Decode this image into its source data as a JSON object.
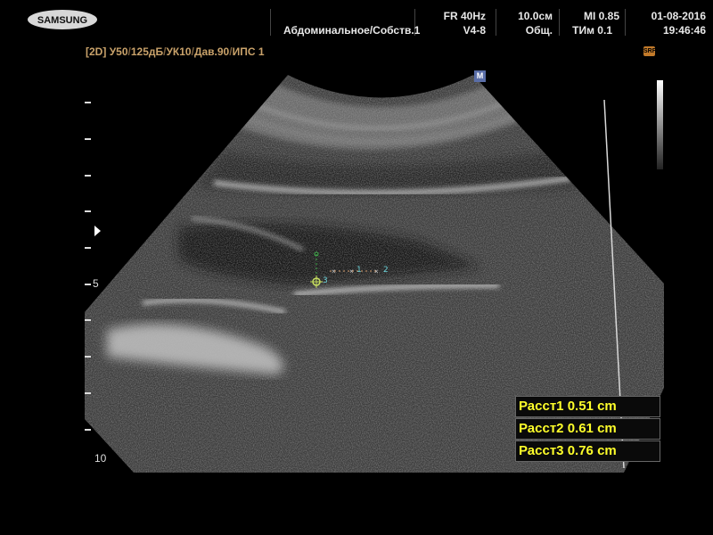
{
  "header": {
    "brand": "SAMSUNG",
    "preset": "Абдоминальное/Собств.1",
    "frame_rate": "FR 40Hz",
    "probe": "V4-8",
    "depth": "10.0см",
    "depth_mode": "Общ.",
    "mi": "MI  0.85",
    "tim": "ТИм 0.1",
    "date": "01-08-2016",
    "time": "19:46:46"
  },
  "mode_line": {
    "mode": "[2D]",
    "params": [
      "У50",
      "125дБ",
      "УК10",
      "Дав.90",
      "ИПС 1"
    ]
  },
  "icons": {
    "top_right": "srf-icon",
    "orientation": "M"
  },
  "depth_scale": {
    "mid_label": "5",
    "bottom_label": "10"
  },
  "calipers": {
    "c1": "1",
    "c2": "2",
    "c3": "3"
  },
  "measurements": [
    {
      "label": "Расст1",
      "value": "0.51 cm"
    },
    {
      "label": "Расст2",
      "value": "0.61 cm"
    },
    {
      "label": "Расст3",
      "value": "0.76 cm"
    }
  ],
  "colors": {
    "measure_text": "#ffff2a",
    "caliper": "#6cd2d8",
    "mode_line": "#c9a26a"
  }
}
